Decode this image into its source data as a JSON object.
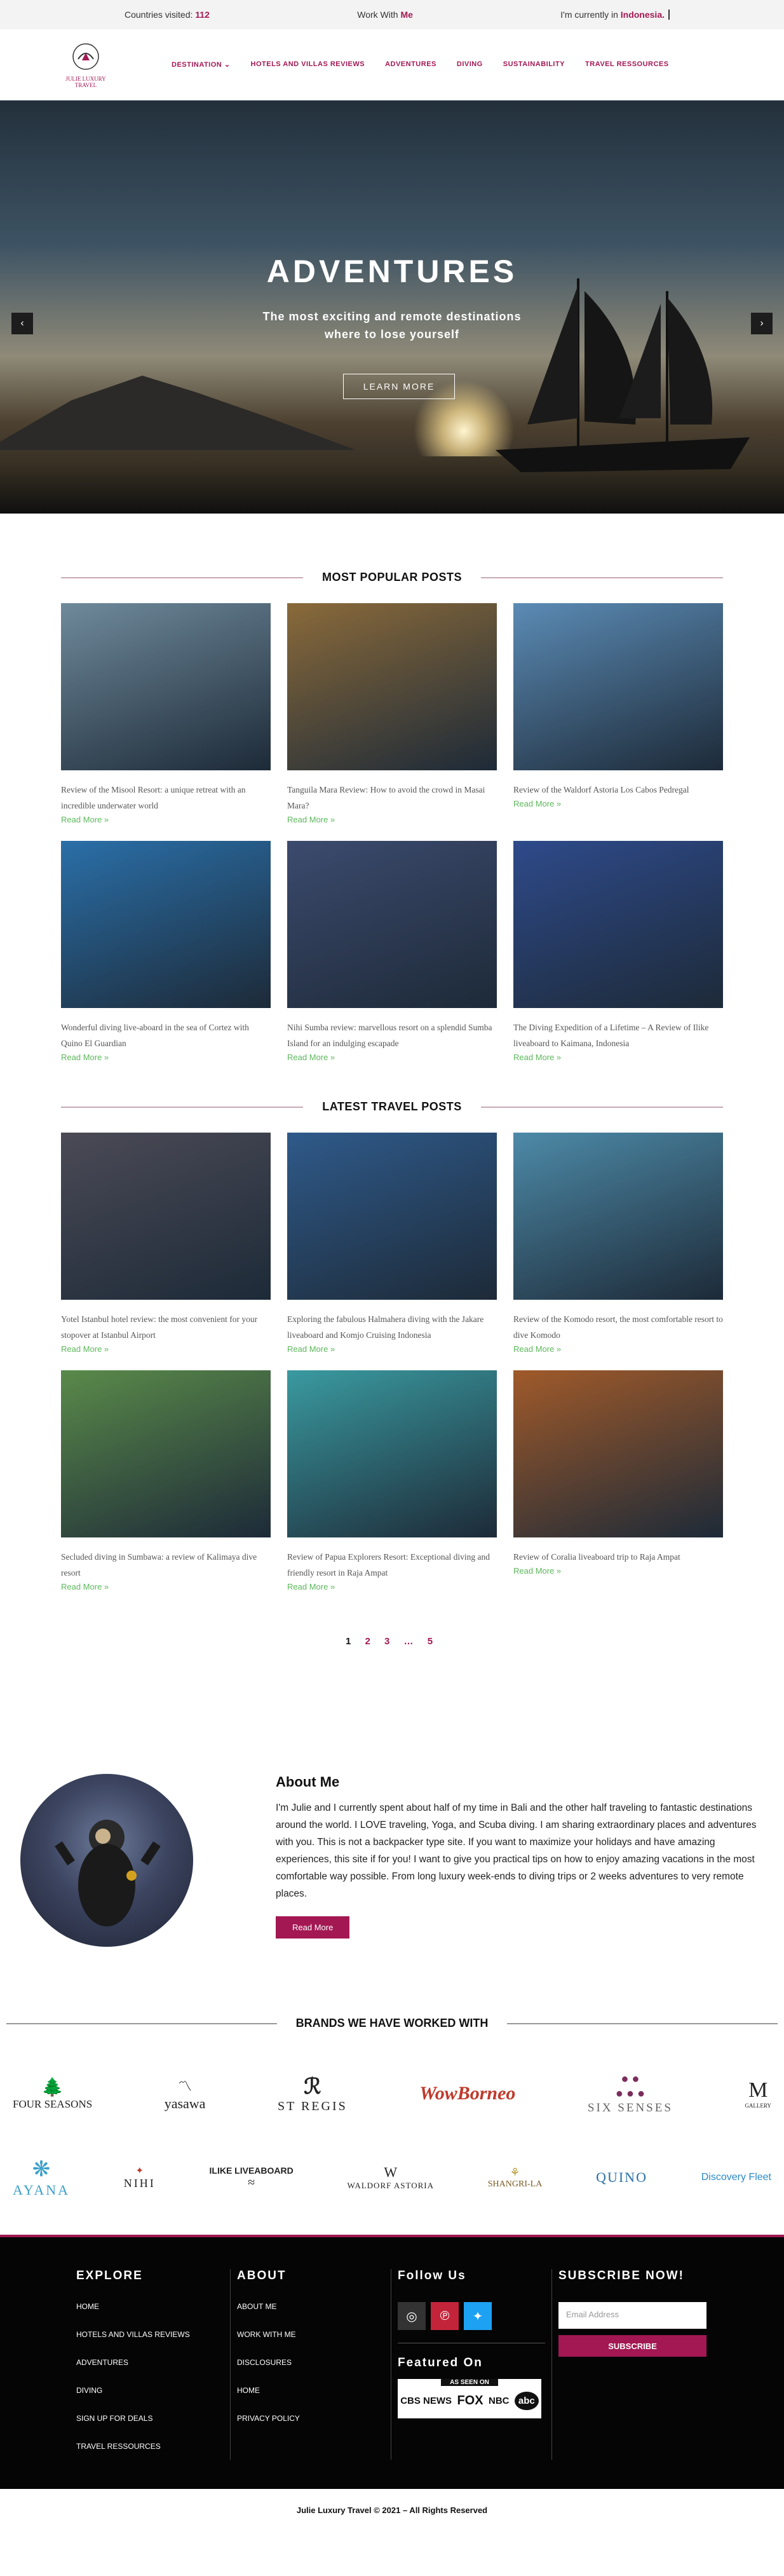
{
  "topbar": {
    "countries_label": "Countries visited:",
    "countries_count": "112",
    "work_with_label": "Work With",
    "work_with_me": "Me",
    "current_label": "I'm currently in",
    "current_location": "Indonesia."
  },
  "logo": {
    "line1": "JULIE LUXURY",
    "line2": "TRAVEL"
  },
  "nav": {
    "items": [
      "DESTINATION",
      "HOTELS AND VILLAS REVIEWS",
      "ADVENTURES",
      "DIVING",
      "SUSTAINABILITY",
      "TRAVEL RESSOURCES"
    ]
  },
  "hero": {
    "title": "ADVENTURES",
    "subtitle": "The most exciting and remote destinations where to lose yourself",
    "button": "LEARN MORE",
    "prev": "‹",
    "next": "›"
  },
  "popular": {
    "title": "MOST POPULAR POSTS",
    "posts": [
      {
        "caption": "Review of the Misool Resort: a unique retreat with an incredible underwater world",
        "more": "Read More »",
        "color": "#6f8a9b"
      },
      {
        "caption": "Tanguila Mara Review: How to avoid the crowd in Masai Mara?",
        "more": "Read More »",
        "color": "#8a6a3a"
      },
      {
        "caption": "Review of the Waldorf Astoria Los Cabos Pedregal",
        "more": "Read More »",
        "color": "#5b8bb5"
      },
      {
        "caption": "Wonderful diving live-aboard in the sea of Cortez with Quino El Guardian",
        "more": "Read More »",
        "color": "#2a6fa8"
      },
      {
        "caption": "Nihi Sumba review: marvellous resort on a splendid Sumba Island for an indulging escapade",
        "more": "Read More »",
        "color": "#3c4a6e"
      },
      {
        "caption": "The Diving Expedition of a Lifetime – A Review of Ilike liveaboard to Kaimana, Indonesia",
        "more": "Read More »",
        "color": "#2e4a8a"
      }
    ]
  },
  "latest": {
    "title": "LATEST TRAVEL POSTS",
    "posts": [
      {
        "caption": "Yotel Istanbul hotel review: the most convenient for your stopover at Istanbul Airport",
        "more": "Read More »",
        "color": "#4b4a56"
      },
      {
        "caption": "Exploring the fabulous Halmahera diving with the Jakare liveaboard and Komjo Cruising Indonesia",
        "more": "Read More »",
        "color": "#2f5a8a"
      },
      {
        "caption": "Review of the Komodo resort, the most comfortable resort to dive Komodo",
        "more": "Read More »",
        "color": "#4d8aa8"
      },
      {
        "caption": "Secluded diving in Sumbawa: a review of Kalimaya dive resort",
        "more": "Read More »",
        "color": "#5a8a4a"
      },
      {
        "caption": "Review of Papua Explorers Resort: Exceptional diving and friendly resort in Raja Ampat",
        "more": "Read More »",
        "color": "#3a9aa0"
      },
      {
        "caption": "Review of Coralia liveaboard trip to Raja Ampat",
        "more": "Read More »",
        "color": "#a05a2a"
      }
    ]
  },
  "pagination": {
    "pages": [
      "1",
      "2",
      "3",
      "…",
      "5"
    ]
  },
  "about": {
    "title": "About Me",
    "text": "I'm Julie and I currently spent about half of my time in Bali and the other half traveling to fantastic destinations around the world. I LOVE traveling, Yoga, and Scuba diving. I am sharing extraordinary places and adventures with you. This is not a backpacker type site. If you want to maximize your holidays and have amazing experiences, this site if for you! I want to give you practical tips on how to enjoy amazing vacations in the most comfortable way possible. From long luxury week-ends to diving trips or 2 weeks adventures to very remote places.",
    "button": "Read More"
  },
  "brands": {
    "title": "BRANDS WE HAVE WORKED WITH",
    "row1": [
      "FOUR SEASONS",
      "yasawa",
      "ST REGIS",
      "WowBorneo",
      "SIX SENSES",
      "GALLERY"
    ],
    "row2": [
      "AYANA",
      "NIHI",
      "ILIKE LIVEABOARD",
      "WALDORF ASTORIA",
      "SHANGRI-LA",
      "QUINO",
      "Discovery Fleet"
    ]
  },
  "footer": {
    "explore": {
      "title": "EXPLORE",
      "items": [
        "HOME",
        "HOTELS AND VILLAS REVIEWS",
        "ADVENTURES",
        "DIVING",
        "SIGN UP FOR DEALS",
        "TRAVEL RESSOURCES"
      ]
    },
    "about": {
      "title": "ABOUT",
      "items": [
        "ABOUT ME",
        "WORK WITH ME",
        "DISCLOSURES",
        "HOME",
        "PRIVACY POLICY"
      ]
    },
    "follow": {
      "title": "Follow Us",
      "featured": "Featured On",
      "as_seen": "AS SEEN ON",
      "media": [
        "CBS NEWS",
        "FOX",
        "NBC",
        "abc"
      ]
    },
    "subscribe": {
      "title": "SUBSCRIBE NOW!",
      "placeholder": "Email Address",
      "button": "SUBSCRIBE"
    },
    "copyright": "Julie Luxury Travel © 2021 – All Rights Reserved"
  }
}
